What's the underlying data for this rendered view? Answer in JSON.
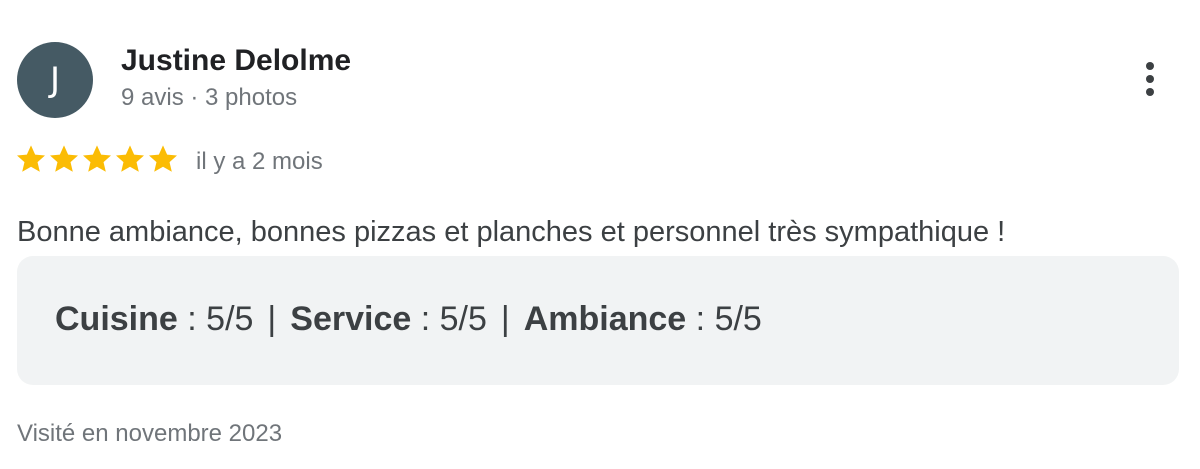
{
  "reviewer": {
    "initial": "J",
    "name": "Justine Delolme",
    "meta": "9 avis · 3 photos"
  },
  "rating": {
    "stars": 5,
    "max": 5,
    "star_color": "#fbbc04"
  },
  "time_ago": "il y a 2 mois",
  "review_text": "Bonne ambiance, bonnes pizzas et planches et personnel très sympathique !",
  "sub_ratings": [
    {
      "label": "Cuisine",
      "value": "5/5"
    },
    {
      "label": "Service",
      "value": "5/5"
    },
    {
      "label": "Ambiance",
      "value": "5/5"
    }
  ],
  "visited": "Visité en novembre 2023",
  "icons": {
    "more": "more-vert-icon",
    "star": "star-icon"
  }
}
